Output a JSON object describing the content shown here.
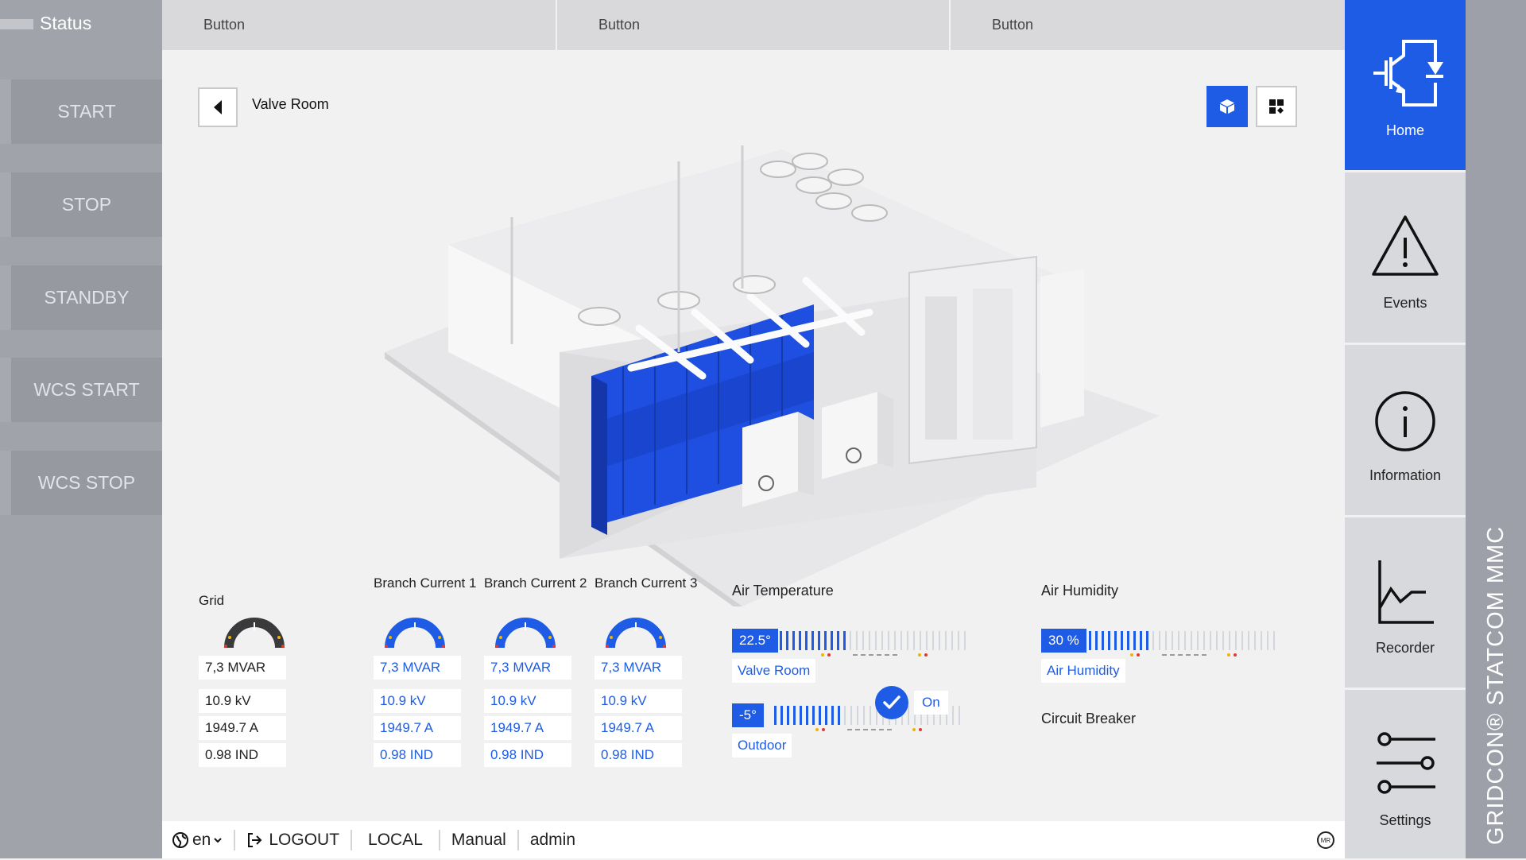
{
  "sidebar": {
    "status_label": "Status",
    "buttons": [
      {
        "label": "START"
      },
      {
        "label": "STOP"
      },
      {
        "label": "STANDBY"
      },
      {
        "label": "WCS START"
      },
      {
        "label": "WCS STOP"
      }
    ]
  },
  "tabs": [
    {
      "label": "Button"
    },
    {
      "label": "Button"
    },
    {
      "label": "Button"
    }
  ],
  "view": {
    "title": "Valve Room",
    "mode_3d_icon": "cube-icon",
    "mode_grid_icon": "grid-icon"
  },
  "gauges": [
    {
      "title": "Grid",
      "power": "7,3 MVAR",
      "voltage": "10.9 kV",
      "current": "1949.7 A",
      "pf": "0.98 IND",
      "style": "dark"
    },
    {
      "title": "Branch Current 1",
      "power": "7,3 MVAR",
      "voltage": "10.9 kV",
      "current": "1949.7 A",
      "pf": "0.98 IND",
      "style": "blue"
    },
    {
      "title": "Branch Current 2",
      "power": "7,3 MVAR",
      "voltage": "10.9 kV",
      "current": "1949.7 A",
      "pf": "0.98 IND",
      "style": "blue"
    },
    {
      "title": "Branch Current 3",
      "power": "7,3 MVAR",
      "voltage": "10.9 kV",
      "current": "1949.7 A",
      "pf": "0.98 IND",
      "style": "blue"
    }
  ],
  "air_temperature": {
    "title": "Air Temperature",
    "readings": [
      {
        "value": "22.5°",
        "label": "Valve Room",
        "level": 0.35
      },
      {
        "value": "-5°",
        "label": "Outdoor",
        "level": 0.35
      }
    ]
  },
  "air_humidity": {
    "title": "Air Humidity",
    "value": "30 %",
    "label": "Air Humidity",
    "level": 0.33
  },
  "circuit_breaker": {
    "title": "Circuit Breaker",
    "state": "On"
  },
  "bottom_bar": {
    "language": "en",
    "logout": "LOGOUT",
    "mode": "LOCAL",
    "control": "Manual",
    "user": "admin",
    "logo": "MR"
  },
  "nav": [
    {
      "label": "Home",
      "icon": "igbt-icon",
      "active": true
    },
    {
      "label": "Events",
      "icon": "warning-icon"
    },
    {
      "label": "Information",
      "icon": "info-icon"
    },
    {
      "label": "Recorder",
      "icon": "chart-icon"
    },
    {
      "label": "Settings",
      "icon": "sliders-icon"
    }
  ],
  "product": {
    "name": "GRIDCON® STATCOM MMC"
  },
  "colors": {
    "accent": "#1e5ce6",
    "sidebar": "#a0a3aa"
  }
}
